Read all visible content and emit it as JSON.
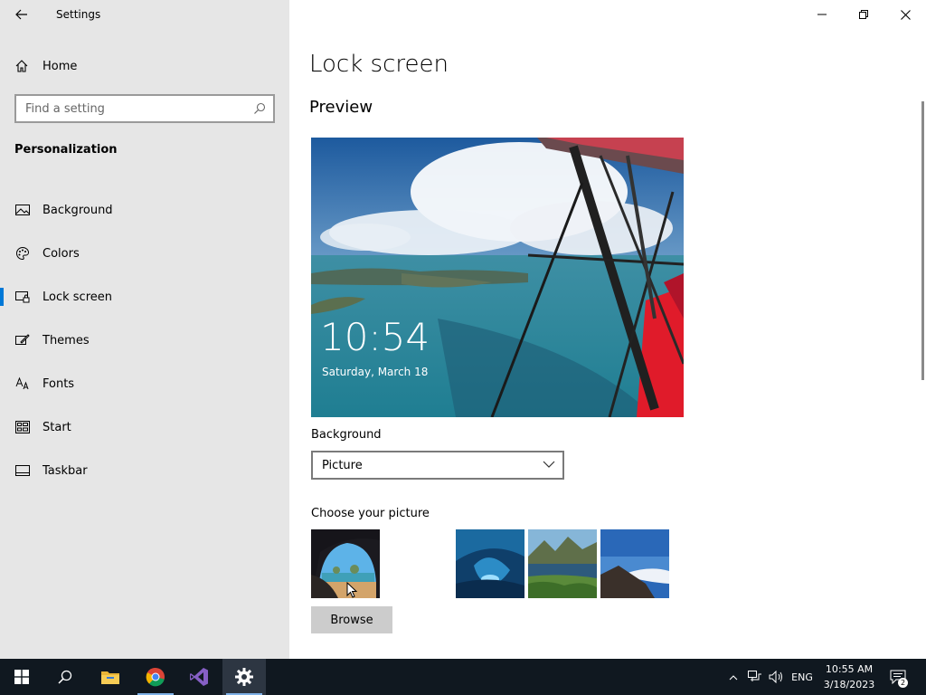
{
  "window": {
    "title": "Settings"
  },
  "sidebar": {
    "home_label": "Home",
    "search_placeholder": "Find a setting",
    "section_title": "Personalization",
    "items": [
      {
        "label": "Background",
        "icon": "picture-icon"
      },
      {
        "label": "Colors",
        "icon": "palette-icon"
      },
      {
        "label": "Lock screen",
        "icon": "lock-screen-icon",
        "selected": true
      },
      {
        "label": "Themes",
        "icon": "brush-icon"
      },
      {
        "label": "Fonts",
        "icon": "font-icon"
      },
      {
        "label": "Start",
        "icon": "start-icon"
      },
      {
        "label": "Taskbar",
        "icon": "taskbar-icon"
      }
    ]
  },
  "main": {
    "title": "Lock screen",
    "preview_heading": "Preview",
    "preview_time": "10:54",
    "preview_date": "Saturday, March 18",
    "background_label": "Background",
    "background_value": "Picture",
    "choose_label": "Choose your picture",
    "browse_label": "Browse"
  },
  "taskbar": {
    "apps": [
      "start-icon",
      "search-icon",
      "file-explorer-icon",
      "chrome-icon",
      "visual-studio-icon",
      "settings-icon"
    ],
    "language": "ENG",
    "time": "10:55 AM",
    "date": "3/18/2023",
    "notification_count": "2"
  },
  "colors": {
    "accent": "#0078d7",
    "sidebar_bg": "#e6e6e6",
    "taskbar_bg": "#101820",
    "lock_red": "#e01b2a"
  }
}
